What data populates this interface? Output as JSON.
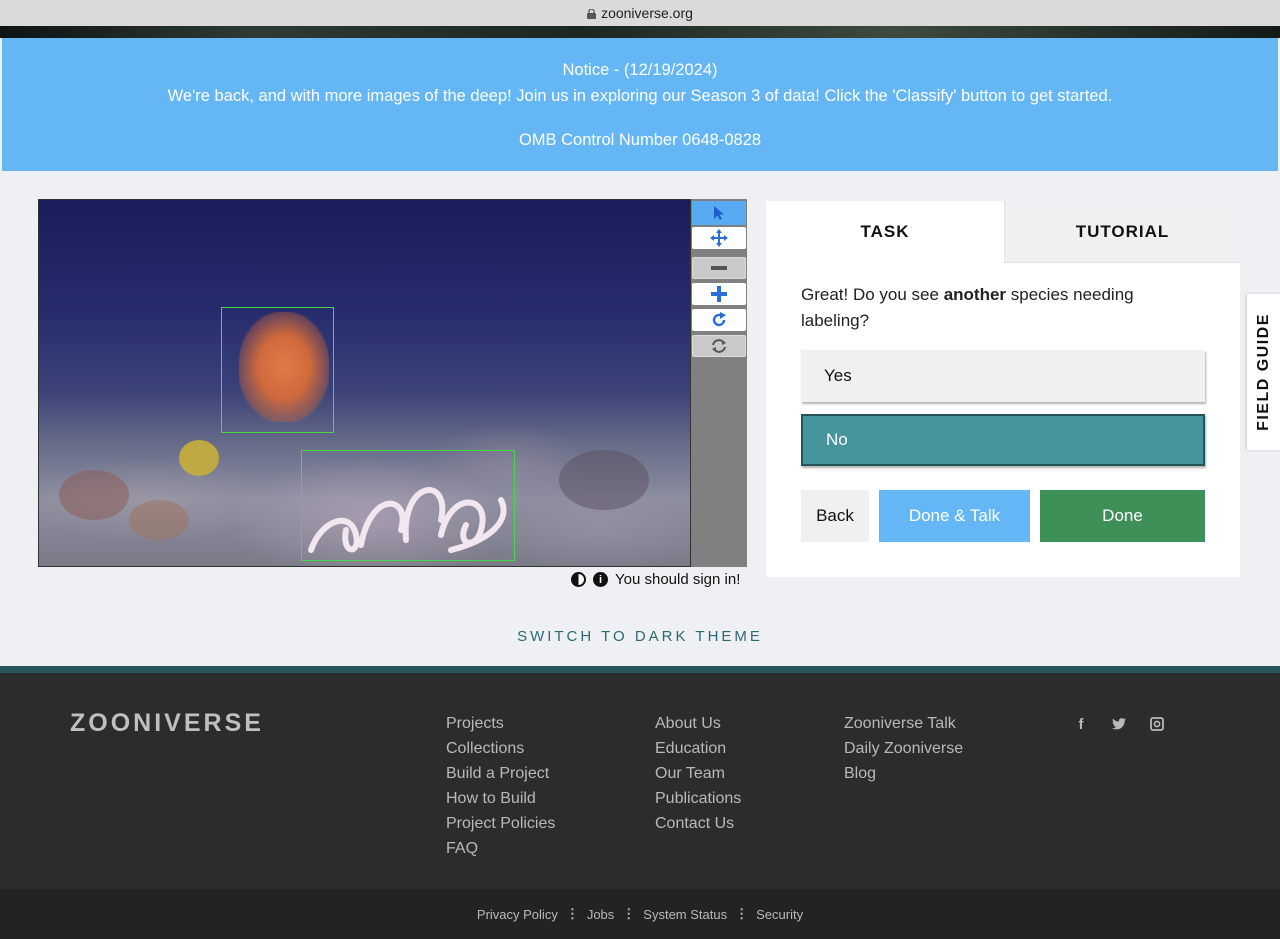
{
  "browser": {
    "url": "zooniverse.org"
  },
  "notice": {
    "title": "Notice - (12/19/2024)",
    "message": "We're back, and with more images of the deep! Join us in exploring our Season 3 of data! Click the 'Classify' button to get started.",
    "omb": "OMB Control Number 0648-0828"
  },
  "toolbar": {
    "tools": [
      "pointer-icon",
      "move-icon",
      "zoom-out-icon",
      "zoom-in-icon",
      "rotate-icon",
      "reset-icon"
    ]
  },
  "subject_meta": {
    "sign_in": "You should sign in!"
  },
  "task_panel": {
    "tabs": {
      "task": "TASK",
      "tutorial": "TUTORIAL"
    },
    "question_pre": "Great! Do you see ",
    "question_bold": "another",
    "question_post": " species needing labeling?",
    "answers": [
      "Yes",
      "No"
    ],
    "selected_answer": "No",
    "buttons": {
      "back": "Back",
      "done_talk": "Done & Talk",
      "done": "Done"
    }
  },
  "field_guide": "FIELD GUIDE",
  "theme_switch": "SWITCH TO DARK THEME",
  "footer": {
    "logo": "ZOONIVERSE",
    "col1": [
      "Projects",
      "Collections",
      "Build a Project",
      "How to Build",
      "Project Policies",
      "FAQ"
    ],
    "col2": [
      "About Us",
      "Education",
      "Our Team",
      "Publications",
      "Contact Us"
    ],
    "col3": [
      "Zooniverse Talk",
      "Daily Zooniverse",
      "Blog"
    ],
    "social": [
      "facebook-icon",
      "twitter-icon",
      "instagram-icon"
    ],
    "bottom": [
      "Privacy Policy",
      "Jobs",
      "System Status",
      "Security"
    ]
  },
  "colors": {
    "notice_bg": "#65b6f5",
    "selected_answer": "#47959c",
    "done": "#3e8f58",
    "done_talk": "#65b6f5",
    "footer_bg": "#2c2c2c"
  }
}
